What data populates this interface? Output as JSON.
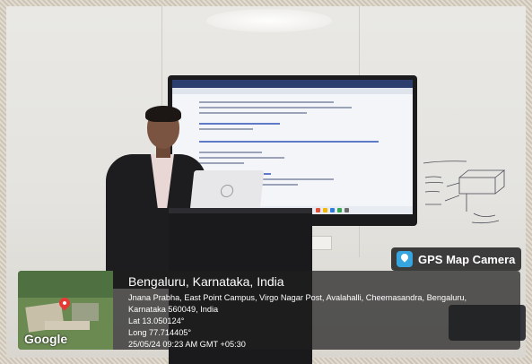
{
  "overlay": {
    "app_label": "GPS Map Camera",
    "app_icon": "gps-map-camera-icon",
    "title": "Bengaluru, Karnataka, India",
    "address_line1": "Jnana Prabha, East Point Campus, Virgo Nagar Post, Avalahalli, Cheemasandra, Bengaluru,",
    "address_line2": "Karnataka 560049, India",
    "lat": "Lat 13.050124°",
    "long": "Long 77.714405°",
    "datetime": "25/05/24 09:23 AM GMT +05:30",
    "map_brand": "Google"
  },
  "colors": {
    "badge_bg": "#191919",
    "card_bg": "#1e1e1e",
    "pin": "#e53935",
    "app_icon": "#37a6e0"
  }
}
